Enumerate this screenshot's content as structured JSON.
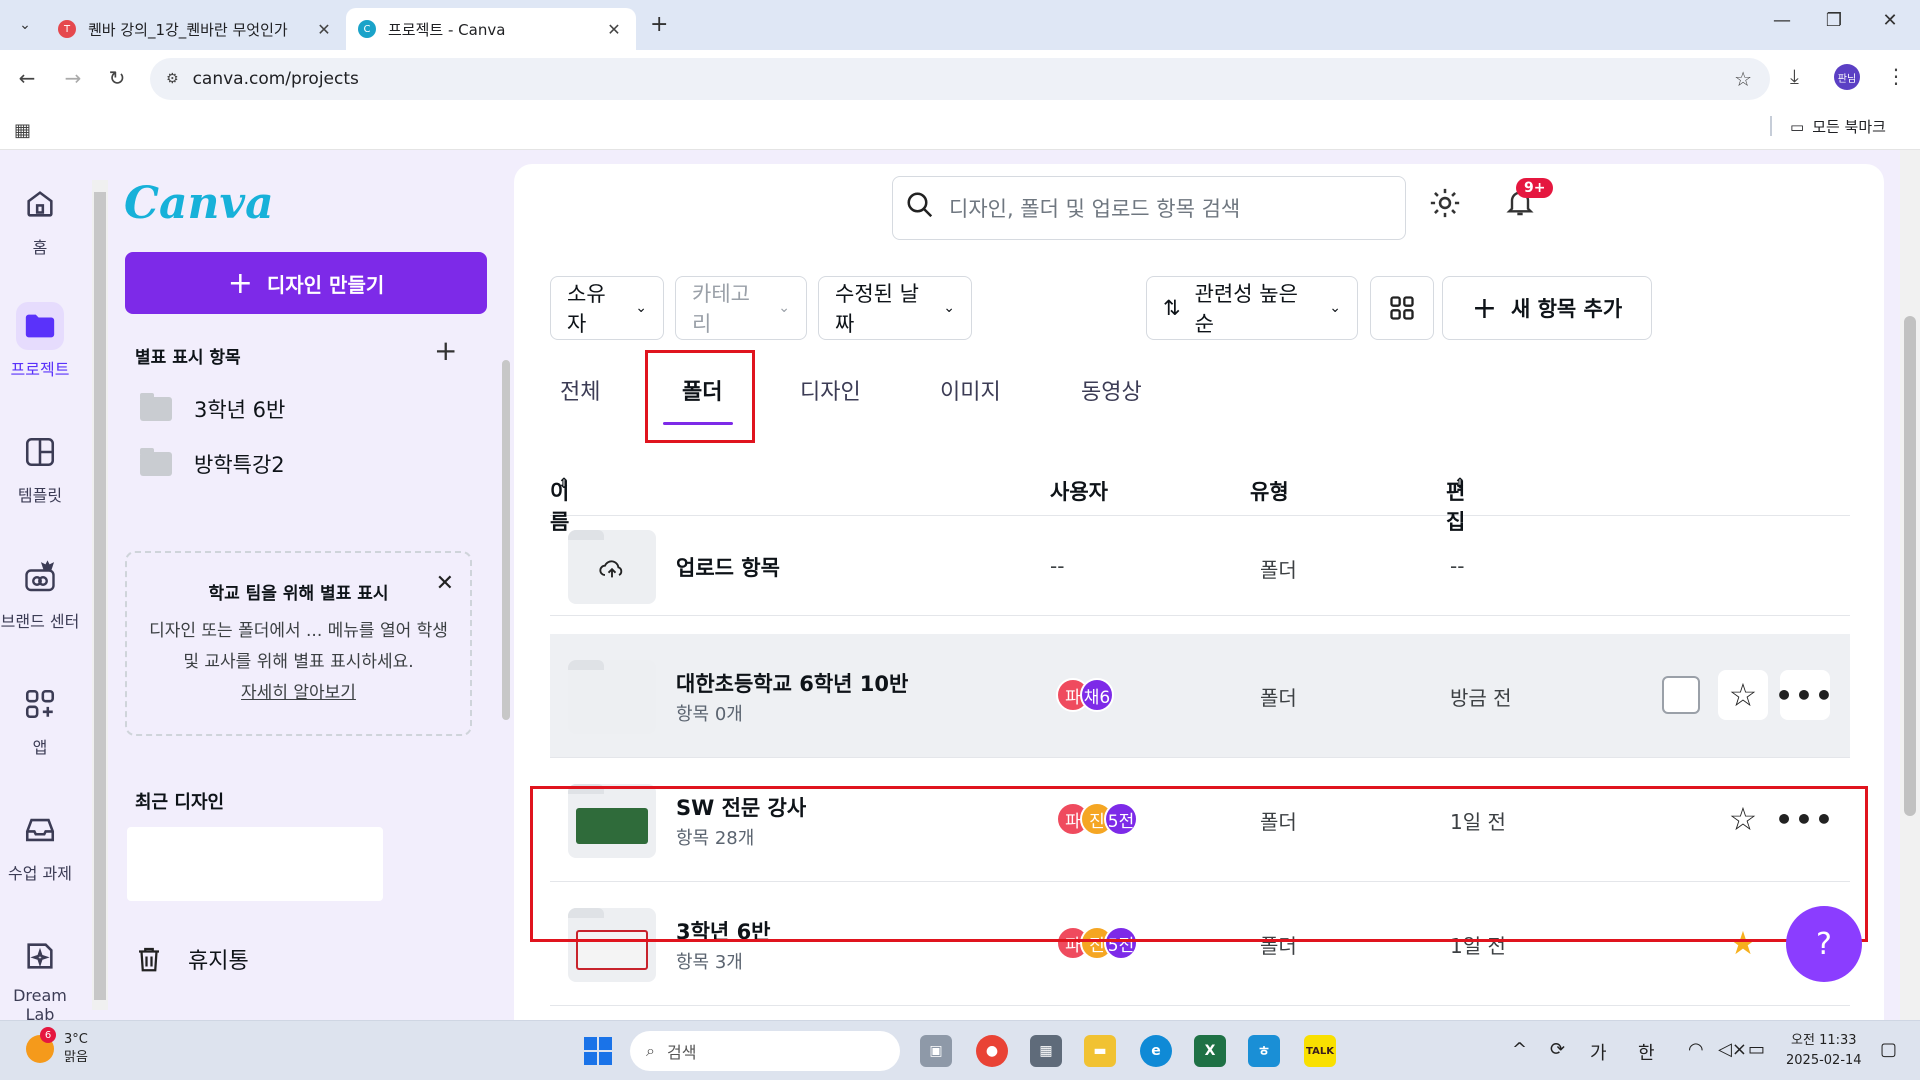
{
  "browser": {
    "tabs": [
      {
        "title": "퀜바 강의_1강_퀜바란 무엇인가",
        "active": false,
        "favicon_color": "#e5484d"
      },
      {
        "title": "프로젝트 - Canva",
        "active": true,
        "favicon_color": "#1aa3c9"
      }
    ],
    "url": "canva.com/projects",
    "profile_label": "판님",
    "all_bookmarks": "모든 북마크"
  },
  "rail": {
    "items": [
      {
        "label": "홈",
        "icon": "home-icon",
        "active": false
      },
      {
        "label": "프로젝트",
        "icon": "folder-icon",
        "active": true
      },
      {
        "label": "템플릿",
        "icon": "template-icon",
        "active": false
      },
      {
        "label": "브랜드 센터",
        "icon": "brand-icon",
        "active": false
      },
      {
        "label": "앱",
        "icon": "apps-icon",
        "active": false
      },
      {
        "label": "수업 과제",
        "icon": "inbox-icon",
        "active": false
      },
      {
        "label": "Dream Lab",
        "icon": "dreamlab-icon",
        "active": false
      }
    ]
  },
  "sidebar": {
    "logo": "Canva",
    "create_label": "디자인 만들기",
    "starred_heading": "별표 표시 항목",
    "starred_items": [
      "3학년 6반",
      "방학특강2"
    ],
    "promo": {
      "title": "학교 팀을 위해 별표 표시",
      "body": "디자인 또는 폴더에서 ... 메뉴를 열어 학생 및 교사를 위해 별표 표시하세요.",
      "link": "자세히 알아보기"
    },
    "recent_heading": "최근 디자인",
    "trash_label": "휴지통"
  },
  "main": {
    "search_placeholder": "디자인, 폴더 및 업로드 항목 검색",
    "notification_badge": "9+",
    "filters": [
      {
        "label": "소유자",
        "disabled": false
      },
      {
        "label": "카테고리",
        "disabled": true
      },
      {
        "label": "수정된 날짜",
        "disabled": false
      }
    ],
    "sort_label": "관련성 높은 순",
    "add_label": "새 항목 추가",
    "content_tabs": [
      "전체",
      "폴더",
      "디자인",
      "이미지",
      "동영상"
    ],
    "active_tab": "폴더",
    "columns": {
      "name": "이름",
      "user": "사용자",
      "type": "유형",
      "edited": "편집"
    },
    "rows": [
      {
        "name": "업로드 항목",
        "sub": "",
        "owner": "--",
        "type": "폴더",
        "edited": "--",
        "avatars": [],
        "starred": null
      },
      {
        "name": "대한초등학교 6학년 10반",
        "sub": "항목 0개",
        "owner": "",
        "type": "폴더",
        "edited": "방금 전",
        "avatars": [
          {
            "t": "파",
            "c": "red"
          },
          {
            "t": "채6",
            "c": "purple"
          }
        ],
        "starred": false
      },
      {
        "name": "SW 전문 강사",
        "sub": "항목 28개",
        "owner": "",
        "type": "폴더",
        "edited": "1일 전",
        "avatars": [
          {
            "t": "파",
            "c": "red"
          },
          {
            "t": "진",
            "c": "orange"
          },
          {
            "t": "5전",
            "c": "purple"
          }
        ],
        "starred": false
      },
      {
        "name": "3학년 6반",
        "sub": "항목 3개",
        "owner": "",
        "type": "폴더",
        "edited": "1일 전",
        "avatars": [
          {
            "t": "파",
            "c": "red"
          },
          {
            "t": "진",
            "c": "orange"
          },
          {
            "t": "5전",
            "c": "purple"
          }
        ],
        "starred": true
      }
    ],
    "help_label": "?"
  },
  "taskbar": {
    "weather_temp": "3°C",
    "weather_text": "맑음",
    "weather_badge": "6",
    "search_label": "검색",
    "tray_ime": "가",
    "tray_lang": "한",
    "time": "오전 11:33",
    "date": "2025-02-14"
  },
  "colors": {
    "brand_purple": "#7d2ae8",
    "highlight_red": "#e0141e",
    "badge_red": "#e5173f"
  }
}
